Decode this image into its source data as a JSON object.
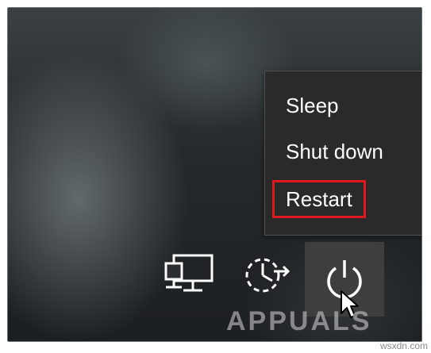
{
  "power_menu": {
    "items": [
      {
        "label": "Sleep"
      },
      {
        "label": "Shut down"
      },
      {
        "label": "Restart",
        "highlighted": true,
        "highlight_color": "#e0181e"
      }
    ]
  },
  "taskbar_icons": [
    {
      "icon": "network-icon"
    },
    {
      "icon": "ease-of-access-icon"
    },
    {
      "icon": "power-icon",
      "active": true
    }
  ],
  "watermark": {
    "logo_text": "APPUALS",
    "site": "wsxdn.com"
  },
  "colors": {
    "menu_bg": "#2a2a2a",
    "menu_text": "#ffffff",
    "highlight": "#e0181e",
    "power_button_bg": "#3e3e3e"
  }
}
